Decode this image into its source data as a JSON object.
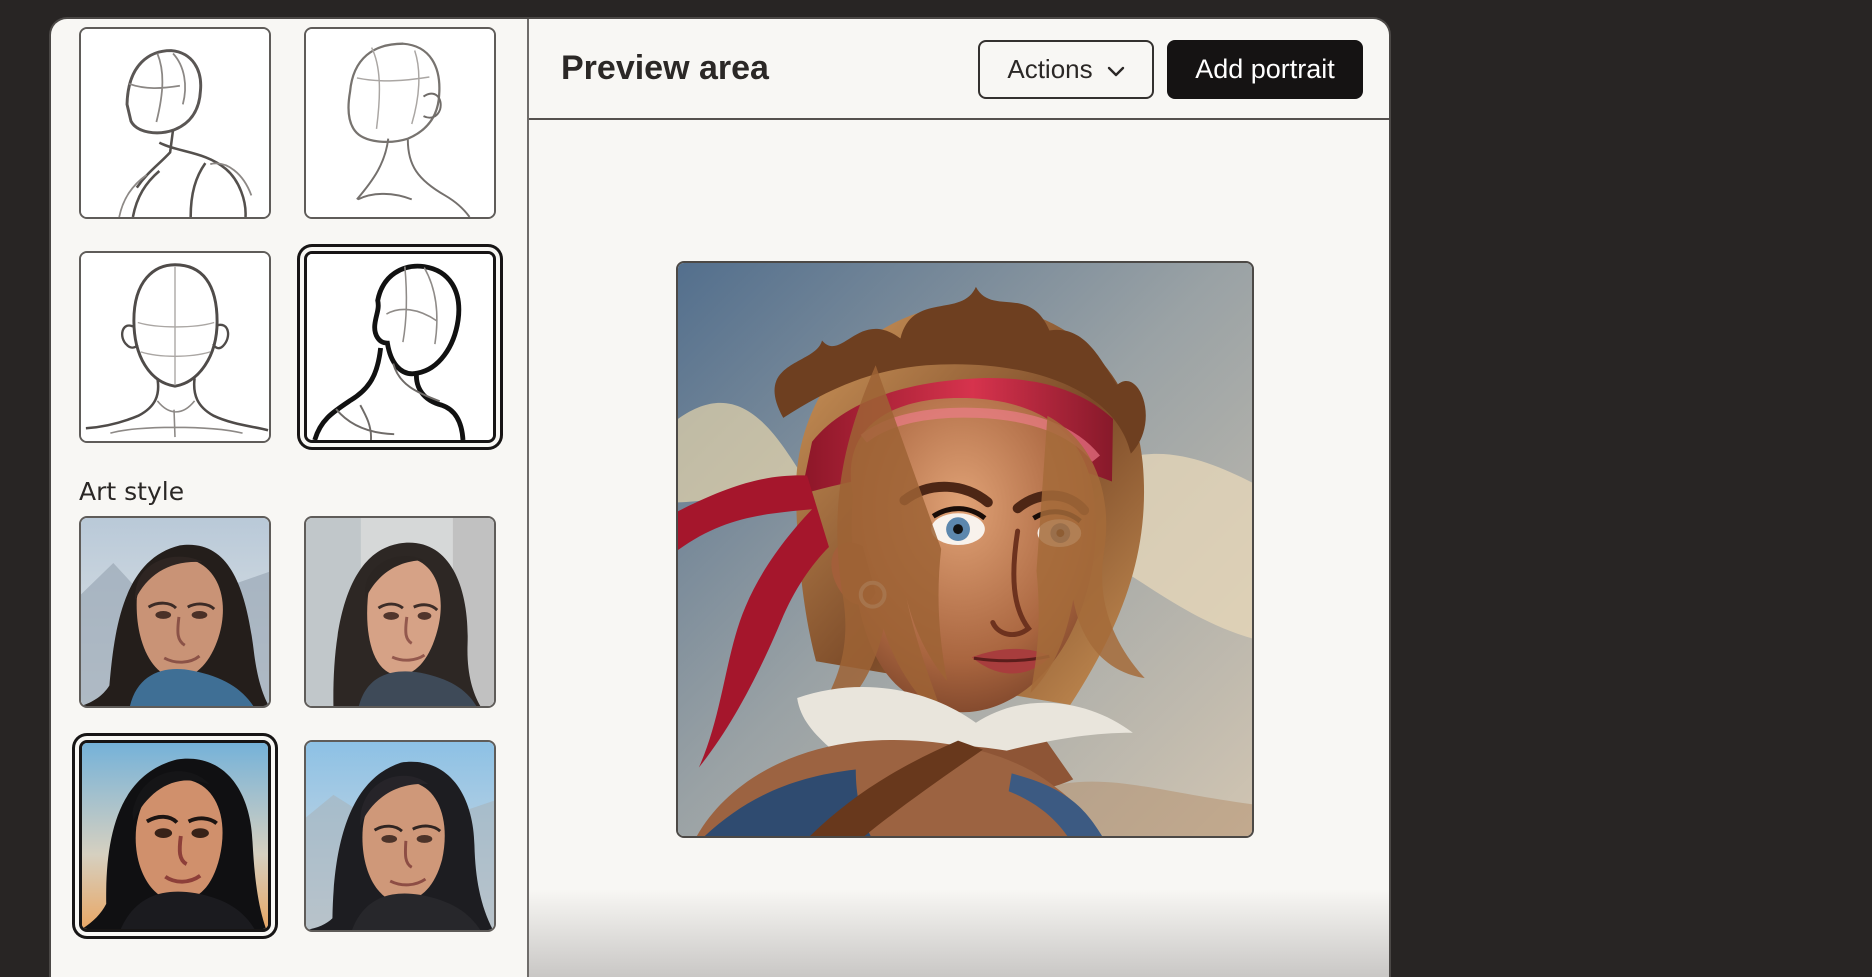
{
  "sidebar": {
    "pose_section": {
      "items": [
        {
          "label": "Three-quarter shoulder pose",
          "selected": false
        },
        {
          "label": "Side profile pose",
          "selected": false
        },
        {
          "label": "Front facing pose",
          "selected": false
        },
        {
          "label": "Bold outline pose",
          "selected": true
        }
      ]
    },
    "art_style_section": {
      "label": "Art style",
      "items": [
        {
          "label": "Realistic style",
          "selected": false
        },
        {
          "label": "Photographic style",
          "selected": false
        },
        {
          "label": "Painted style",
          "selected": true
        },
        {
          "label": "Semi-realistic style",
          "selected": false
        }
      ]
    }
  },
  "preview": {
    "title": "Preview area",
    "actions_label": "Actions",
    "add_portrait_label": "Add portrait",
    "actions_icon": "chevron-down-icon"
  },
  "colors": {
    "page_background": "#282524",
    "panel_background": "#f8f7f4",
    "primary_button": "#151313",
    "selected_border": "#171515"
  }
}
